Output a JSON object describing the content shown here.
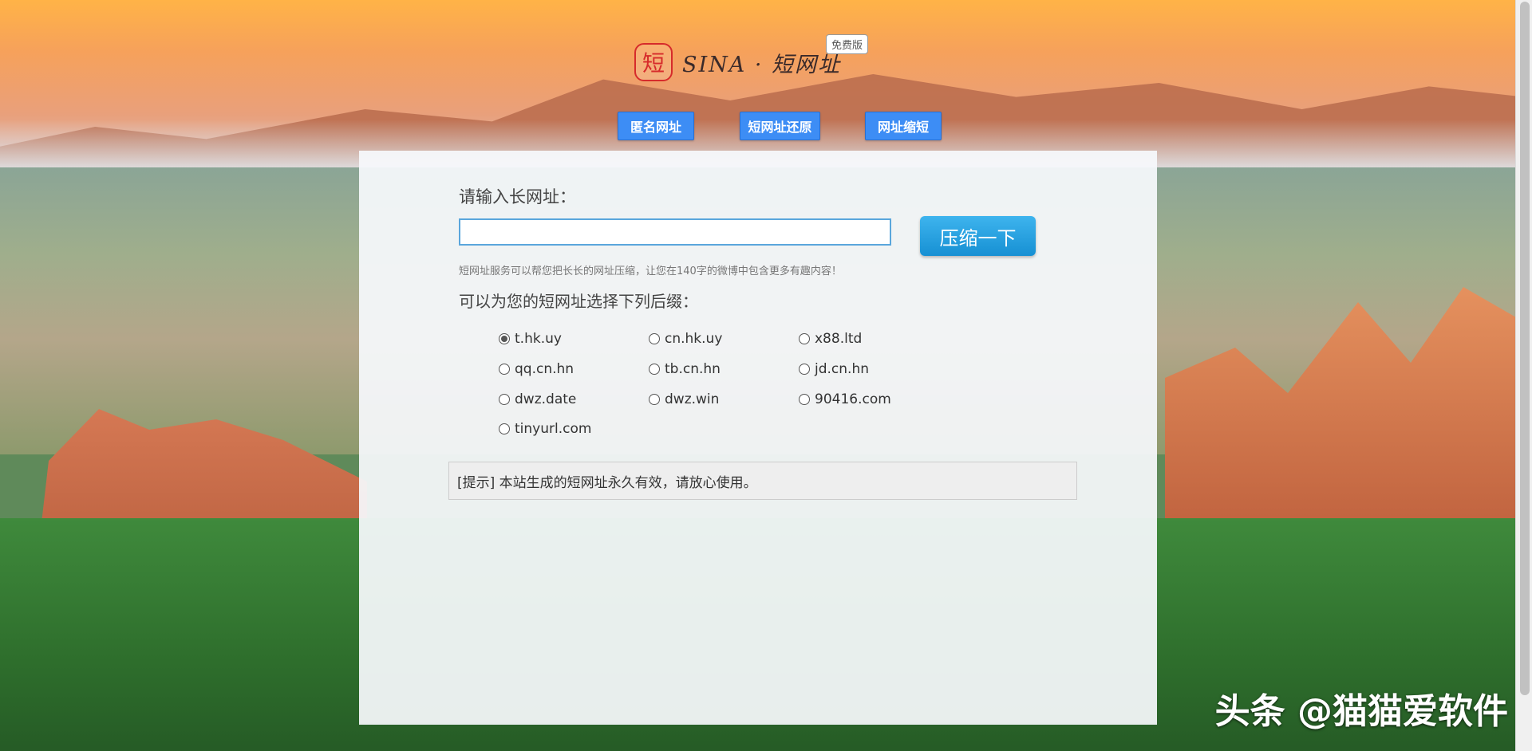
{
  "logo": {
    "mark": "短",
    "text": "SINA · 短网址",
    "badge": "免费版"
  },
  "nav": [
    {
      "label": "匿名网址"
    },
    {
      "label": "短网址还原"
    },
    {
      "label": "网址缩短"
    }
  ],
  "form": {
    "title": "请输入长网址：",
    "input_value": "",
    "input_placeholder": "",
    "submit_label": "压缩一下",
    "hint": "短网址服务可以帮您把长长的网址压缩，让您在140字的微博中包含更多有趣内容！",
    "suffix_title": "可以为您的短网址选择下列后缀：",
    "selected_suffix": "t.hk.uy",
    "suffixes": [
      "t.hk.uy",
      "cn.hk.uy",
      "x88.ltd",
      "qq.cn.hn",
      "tb.cn.hn",
      "jd.cn.hn",
      "dwz.date",
      "dwz.win",
      "90416.com",
      "tinyurl.com"
    ]
  },
  "notice": "[提示] 本站生成的短网址永久有效，请放心使用。",
  "watermark": "头条 @猫猫爱软件",
  "colors": {
    "nav_button": "#3d8df5",
    "submit_button": "#1a95d8",
    "input_border": "#5aa6dc"
  }
}
